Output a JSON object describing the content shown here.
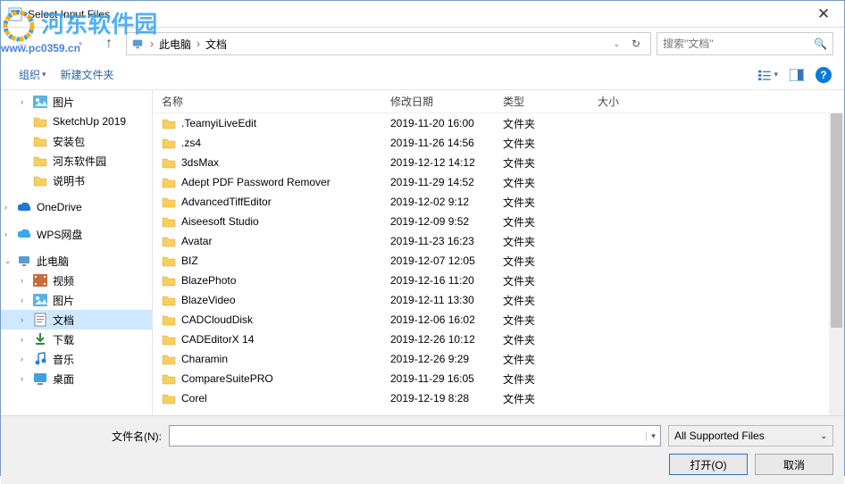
{
  "watermark": {
    "text": "河东软件园",
    "url": "www.pc0359.cn"
  },
  "window": {
    "title": "Select Input Files"
  },
  "breadcrumb": {
    "seg1": "此电脑",
    "seg2": "文档"
  },
  "search": {
    "placeholder": "搜索\"文档\""
  },
  "toolbar": {
    "organize": "组织",
    "newfolder": "新建文件夹"
  },
  "tree": {
    "pictures": "图片",
    "sketchup": "SketchUp 2019",
    "pkg": "安装包",
    "hd": "河东软件园",
    "readme": "说明书",
    "onedrive": "OneDrive",
    "wps": "WPS网盘",
    "thispc": "此电脑",
    "video": "视频",
    "pic2": "图片",
    "docs": "文档",
    "downloads": "下载",
    "music": "音乐",
    "desktop": "桌面"
  },
  "cols": {
    "name": "名称",
    "date": "修改日期",
    "type": "类型",
    "size": "大小"
  },
  "type_folder": "文件夹",
  "files": [
    {
      "name": ".TeamyiLiveEdit",
      "date": "2019-11-20 16:00"
    },
    {
      "name": ".zs4",
      "date": "2019-11-26 14:56"
    },
    {
      "name": "3dsMax",
      "date": "2019-12-12 14:12"
    },
    {
      "name": "Adept PDF Password Remover",
      "date": "2019-11-29 14:52"
    },
    {
      "name": "AdvancedTiffEditor",
      "date": "2019-12-02 9:12"
    },
    {
      "name": "Aiseesoft Studio",
      "date": "2019-12-09 9:52"
    },
    {
      "name": "Avatar",
      "date": "2019-11-23 16:23"
    },
    {
      "name": "BIZ",
      "date": "2019-12-07 12:05"
    },
    {
      "name": "BlazePhoto",
      "date": "2019-12-16 11:20"
    },
    {
      "name": "BlazeVideo",
      "date": "2019-12-11 13:30"
    },
    {
      "name": "CADCloudDisk",
      "date": "2019-12-06 16:02"
    },
    {
      "name": "CADEditorX 14",
      "date": "2019-12-26 10:12"
    },
    {
      "name": "Charamin",
      "date": "2019-12-26 9:29"
    },
    {
      "name": "CompareSuitePRO",
      "date": "2019-11-29 16:05"
    },
    {
      "name": "Corel",
      "date": "2019-12-19 8:28"
    }
  ],
  "footer": {
    "fn_label": "文件名(N):",
    "filter": "All Supported Files",
    "open": "打开(O)",
    "cancel": "取消"
  }
}
